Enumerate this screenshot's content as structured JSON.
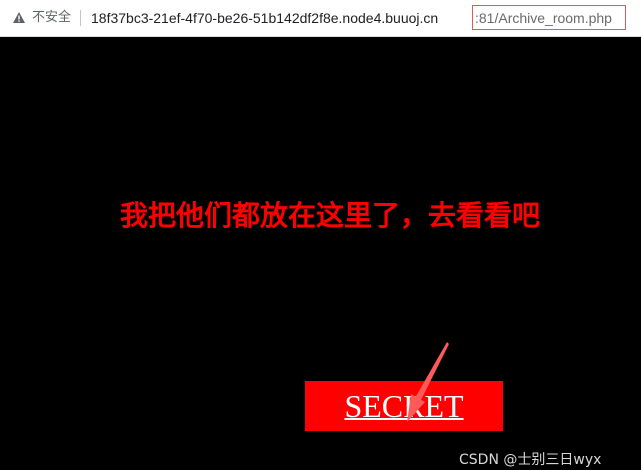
{
  "browser": {
    "security_label": "不安全",
    "url_host": "18f37bc3-21ef-4f70-be26-51b142df2f8e.node4.buuoj.cn",
    "url_path": ":81/Archive_room.php",
    "icons": [
      "warning-icon"
    ]
  },
  "page": {
    "headline": "我把他们都放在这里了，去看看吧",
    "button_label": "SECRET",
    "watermark": "CSDN @士别三日wyx"
  },
  "colors": {
    "background": "#000000",
    "headline": "#ff0000",
    "button_bg": "#ff0000",
    "button_text": "#ffffff",
    "highlight_box": "#e05a5a"
  }
}
